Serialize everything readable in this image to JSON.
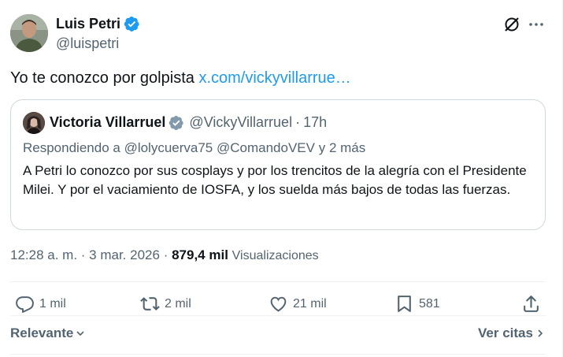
{
  "author": {
    "name": "Luis Petri",
    "handle": "@luispetri"
  },
  "tweet": {
    "text": "Yo te conozco por golpista ",
    "link": "x.com/vickyvillarrue…"
  },
  "quoted": {
    "name": "Victoria Villarruel",
    "handle": "@VickyVillarruel",
    "separator": "·",
    "time": "17h",
    "reply_prefix": "Respondiendo a",
    "mention_1": "@lolycuerva75",
    "mention_2": "@ComandoVEV",
    "reply_suffix": "y 2 más",
    "body": "A Petri lo conozco por sus cosplays y por los trencitos de la alegría con el Presidente Milei. Y por el vaciamiento de IOSFA, y los suelda más bajos de todas las fuerzas."
  },
  "meta": {
    "timestamp": "12:28 a. m. · 3 mar. 2026",
    "separator": "·",
    "views_count": "879,4 mil",
    "views_label": "Visualizaciones"
  },
  "actions": {
    "replies": "1 mil",
    "reposts": "2 mil",
    "likes": "21 mil",
    "bookmarks": "581"
  },
  "footer": {
    "sort_label": "Relevante",
    "quotes_label": "Ver citas"
  },
  "colors": {
    "link": "#1d9bf0",
    "secondary_text": "#536471",
    "primary_text": "#0f1419",
    "verified_badge": "#1d9bf0"
  },
  "icons": {
    "verified": "verified-badge-icon",
    "grok": "grok-icon",
    "more": "more-icon",
    "reply": "reply-icon",
    "repost": "repost-icon",
    "like": "like-icon",
    "bookmark": "bookmark-icon",
    "share": "share-icon"
  }
}
